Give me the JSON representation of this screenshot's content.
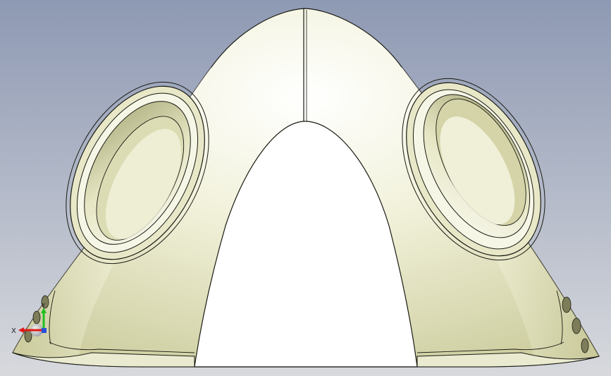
{
  "colors": {
    "background_top": "#8e99b3",
    "background_bottom": "#d7d9dd",
    "model_light": "#fbfbf2",
    "model_mid": "#e9e9c8",
    "model_shadow": "#b9b98c",
    "edge": "#1a1a14",
    "axis_x": "#e01818",
    "axis_y": "#1fbf1f",
    "axis_z": "#2a4fd8"
  },
  "triad": {
    "x_label": "X",
    "y_label": "Y"
  }
}
